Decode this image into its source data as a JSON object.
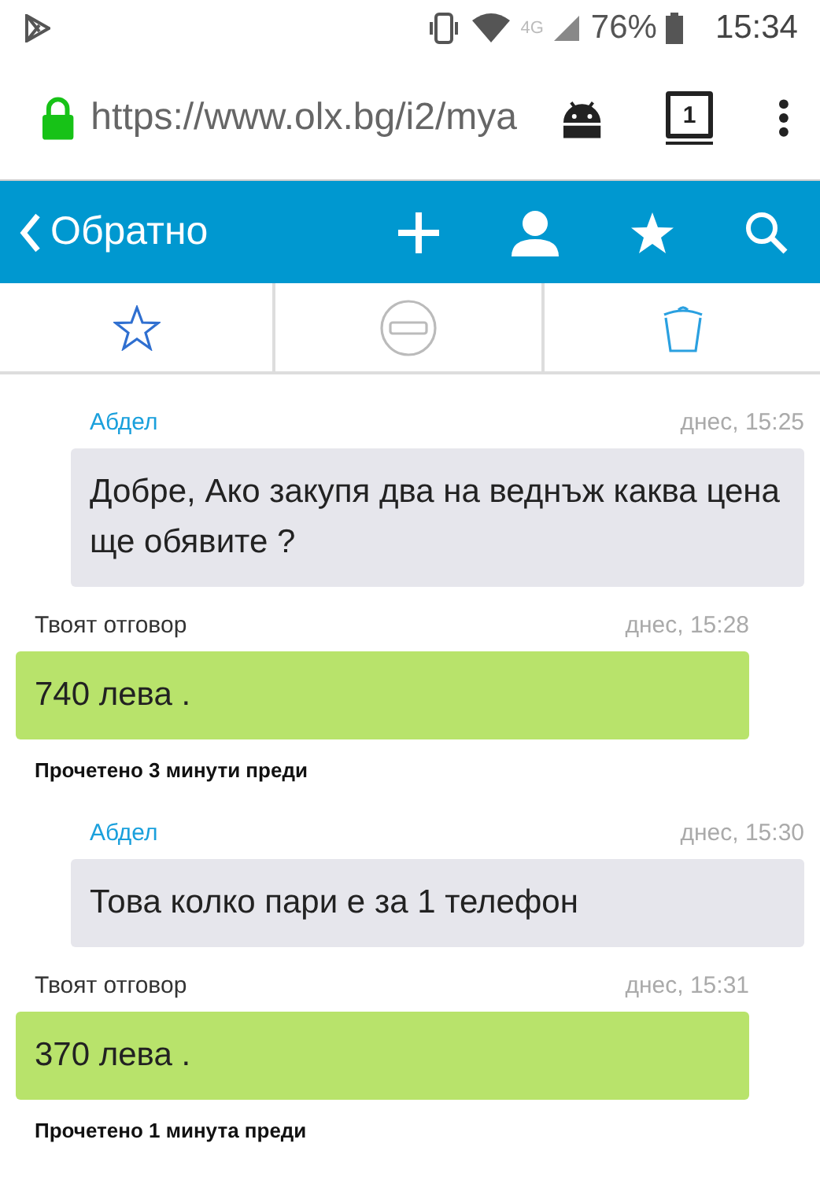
{
  "status_bar": {
    "network": "4G",
    "battery": "76%",
    "time": "15:34"
  },
  "browser": {
    "url": "https://www.olx.bg/i2/mya",
    "tab_count": "1"
  },
  "header": {
    "back_label": "Обратно"
  },
  "messages": [
    {
      "kind": "incoming",
      "author": "Абдел",
      "time": "днес, 15:25",
      "text": "Добре, Ако закупя два на веднъж каква цена ще обявите ?"
    },
    {
      "kind": "outgoing",
      "author": "Твоят отговор",
      "time": "днес, 15:28",
      "text": "740 лева .",
      "read_status": "Прочетено 3 минути преди"
    },
    {
      "kind": "incoming",
      "author": "Абдел",
      "time": "днес, 15:30",
      "text": "Това колко пари е за 1 телефон"
    },
    {
      "kind": "outgoing",
      "author": "Твоят отговор",
      "time": "днес, 15:31",
      "text": "370 лева .",
      "read_status": "Прочетено 1 минута преди"
    }
  ]
}
